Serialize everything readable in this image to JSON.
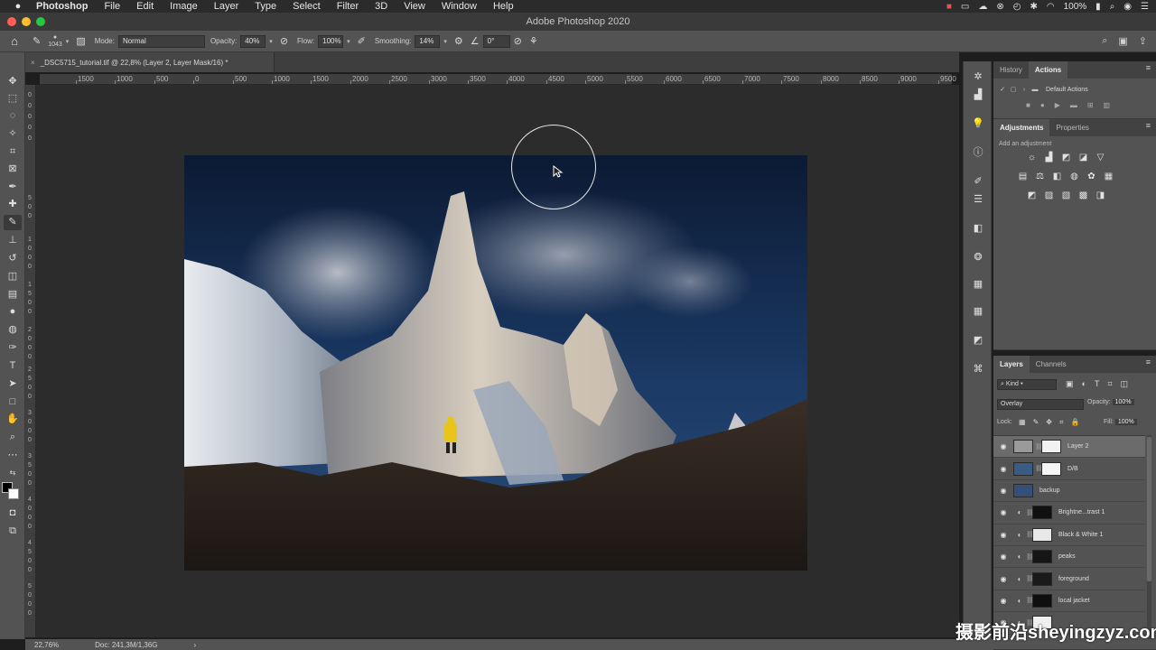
{
  "menubar": {
    "app": "Photoshop",
    "items": [
      "File",
      "Edit",
      "Image",
      "Layer",
      "Type",
      "Select",
      "Filter",
      "3D",
      "View",
      "Window",
      "Help"
    ],
    "battery": "100%"
  },
  "window": {
    "title": "Adobe Photoshop 2020"
  },
  "options_bar": {
    "brush_size": "1043",
    "mode_label": "Mode:",
    "mode_value": "Normal",
    "opacity_label": "Opacity:",
    "opacity_value": "40%",
    "flow_label": "Flow:",
    "flow_value": "100%",
    "smoothing_label": "Smoothing:",
    "smoothing_value": "14%",
    "angle_value": "0°"
  },
  "document": {
    "tab_title": "_DSC5715_tutorial.tif @ 22,8% (Layer 2, Layer Mask/16) *",
    "close": "×"
  },
  "ruler_h": [
    "1500",
    "1000",
    "500",
    "0",
    "500",
    "1000",
    "1500",
    "2000",
    "2500",
    "3000",
    "3500",
    "4000",
    "4500",
    "5000",
    "5500",
    "6000",
    "6500",
    "7000",
    "7500",
    "8000",
    "8500",
    "9000",
    "9500"
  ],
  "status": {
    "zoom": "22,76%",
    "doc": "Doc: 241,3M/1,36G",
    "arrow": "›"
  },
  "panels": {
    "history_tab": "History",
    "actions_tab": "Actions",
    "default_actions": "Default Actions",
    "adjustments_tab": "Adjustments",
    "properties_tab": "Properties",
    "add_adjustment": "Add an adjustment",
    "layers_tab": "Layers",
    "channels_tab": "Channels"
  },
  "layers_panel": {
    "filter_kind": "Kind",
    "blend_mode": "Overlay",
    "opacity_label": "Opacity:",
    "opacity_value": "100%",
    "lock_label": "Lock:",
    "fill_label": "Fill:",
    "fill_value": "100%",
    "layers": [
      {
        "name": "Layer 2",
        "selected": true,
        "adjust": false,
        "thumb": "#9a9a9a",
        "mask": "#f2f2f2"
      },
      {
        "name": "D/B",
        "selected": false,
        "adjust": false,
        "thumb": "#3a5b86",
        "mask": "#f5f5f5"
      },
      {
        "name": "backup",
        "selected": false,
        "adjust": false,
        "thumb": "#34507a",
        "mask": ""
      },
      {
        "name": "Brightne...trast 1",
        "selected": false,
        "adjust": true,
        "thumb": "",
        "mask": "#111111"
      },
      {
        "name": "Black & White 1",
        "selected": false,
        "adjust": true,
        "thumb": "",
        "mask": "#e8e8e8"
      },
      {
        "name": "peaks",
        "selected": false,
        "adjust": true,
        "thumb": "",
        "mask": "#151515"
      },
      {
        "name": "foreground",
        "selected": false,
        "adjust": true,
        "thumb": "",
        "mask": "#1a1a1a"
      },
      {
        "name": "local jacket",
        "selected": false,
        "adjust": true,
        "thumb": "",
        "mask": "#0f0f0f"
      },
      {
        "name": "",
        "selected": false,
        "adjust": true,
        "thumb": "",
        "mask": "#f0f0f0"
      }
    ]
  },
  "watermark": "摄影前沿sheyingzyz.com",
  "colors": {
    "panel": "#535353",
    "canvas": "#2c2c2c",
    "accent": "#e8c51a"
  }
}
